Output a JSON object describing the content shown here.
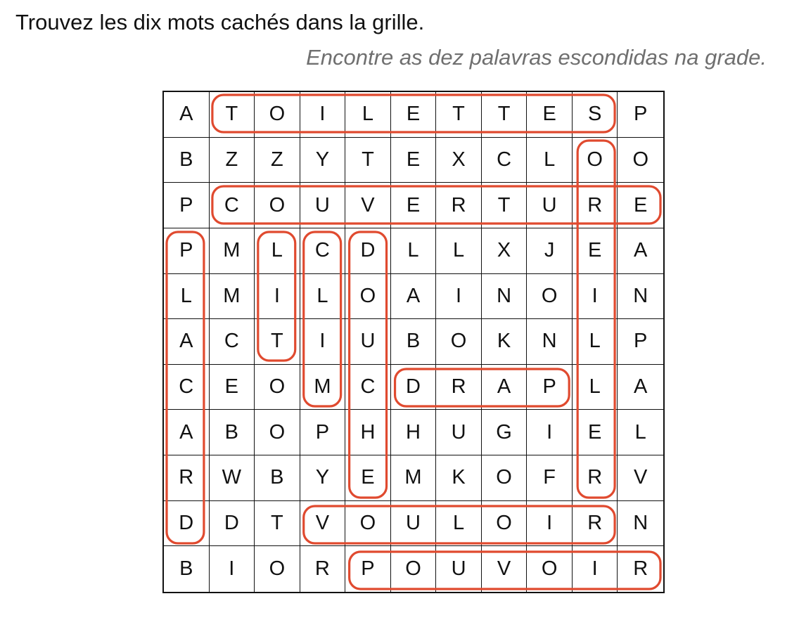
{
  "instructions": {
    "french": "Trouvez les dix mots cachés dans la grille.",
    "portuguese": "Encontre as dez palavras escondidas na grade."
  },
  "grid": {
    "rows": [
      [
        "A",
        "T",
        "O",
        "I",
        "L",
        "E",
        "T",
        "T",
        "E",
        "S",
        "P"
      ],
      [
        "B",
        "Z",
        "Z",
        "Y",
        "T",
        "E",
        "X",
        "C",
        "L",
        "O",
        "O"
      ],
      [
        "P",
        "C",
        "O",
        "U",
        "V",
        "E",
        "R",
        "T",
        "U",
        "R",
        "E"
      ],
      [
        "P",
        "M",
        "L",
        "C",
        "D",
        "L",
        "L",
        "X",
        "J",
        "E",
        "A"
      ],
      [
        "L",
        "M",
        "I",
        "L",
        "O",
        "A",
        "I",
        "N",
        "O",
        "I",
        "N"
      ],
      [
        "A",
        "C",
        "T",
        "I",
        "U",
        "B",
        "O",
        "K",
        "N",
        "L",
        "P"
      ],
      [
        "C",
        "E",
        "O",
        "M",
        "C",
        "D",
        "R",
        "A",
        "P",
        "L",
        "A"
      ],
      [
        "A",
        "B",
        "O",
        "P",
        "H",
        "H",
        "U",
        "G",
        "I",
        "E",
        "L"
      ],
      [
        "R",
        "W",
        "B",
        "Y",
        "E",
        "M",
        "K",
        "O",
        "F",
        "R",
        "V"
      ],
      [
        "D",
        "D",
        "T",
        "V",
        "O",
        "U",
        "L",
        "O",
        "I",
        "R",
        "N"
      ],
      [
        "B",
        "I",
        "O",
        "R",
        "P",
        "O",
        "U",
        "V",
        "O",
        "I",
        "R"
      ]
    ]
  },
  "found_words": [
    {
      "word": "TOILETTES",
      "direction": "horizontal",
      "start": [
        0,
        1
      ],
      "end": [
        0,
        9
      ]
    },
    {
      "word": "COUVERTURE",
      "direction": "horizontal",
      "start": [
        2,
        1
      ],
      "end": [
        2,
        10
      ]
    },
    {
      "word": "DRAP",
      "direction": "horizontal",
      "start": [
        6,
        5
      ],
      "end": [
        6,
        8
      ]
    },
    {
      "word": "VOULOIR",
      "direction": "horizontal",
      "start": [
        9,
        3
      ],
      "end": [
        9,
        9
      ]
    },
    {
      "word": "POUVOIR",
      "direction": "horizontal",
      "start": [
        10,
        4
      ],
      "end": [
        10,
        10
      ]
    },
    {
      "word": "PLACARD",
      "direction": "vertical",
      "start": [
        3,
        0
      ],
      "end": [
        9,
        0
      ]
    },
    {
      "word": "LIT",
      "direction": "vertical",
      "start": [
        3,
        2
      ],
      "end": [
        5,
        2
      ]
    },
    {
      "word": "CLIM",
      "direction": "vertical",
      "start": [
        3,
        3
      ],
      "end": [
        6,
        3
      ]
    },
    {
      "word": "DOUCHE",
      "direction": "vertical",
      "start": [
        3,
        4
      ],
      "end": [
        8,
        4
      ]
    },
    {
      "word": "OREILLER",
      "direction": "vertical",
      "start": [
        1,
        9
      ],
      "end": [
        8,
        9
      ]
    }
  ],
  "highlight_color": "#e04a2f"
}
